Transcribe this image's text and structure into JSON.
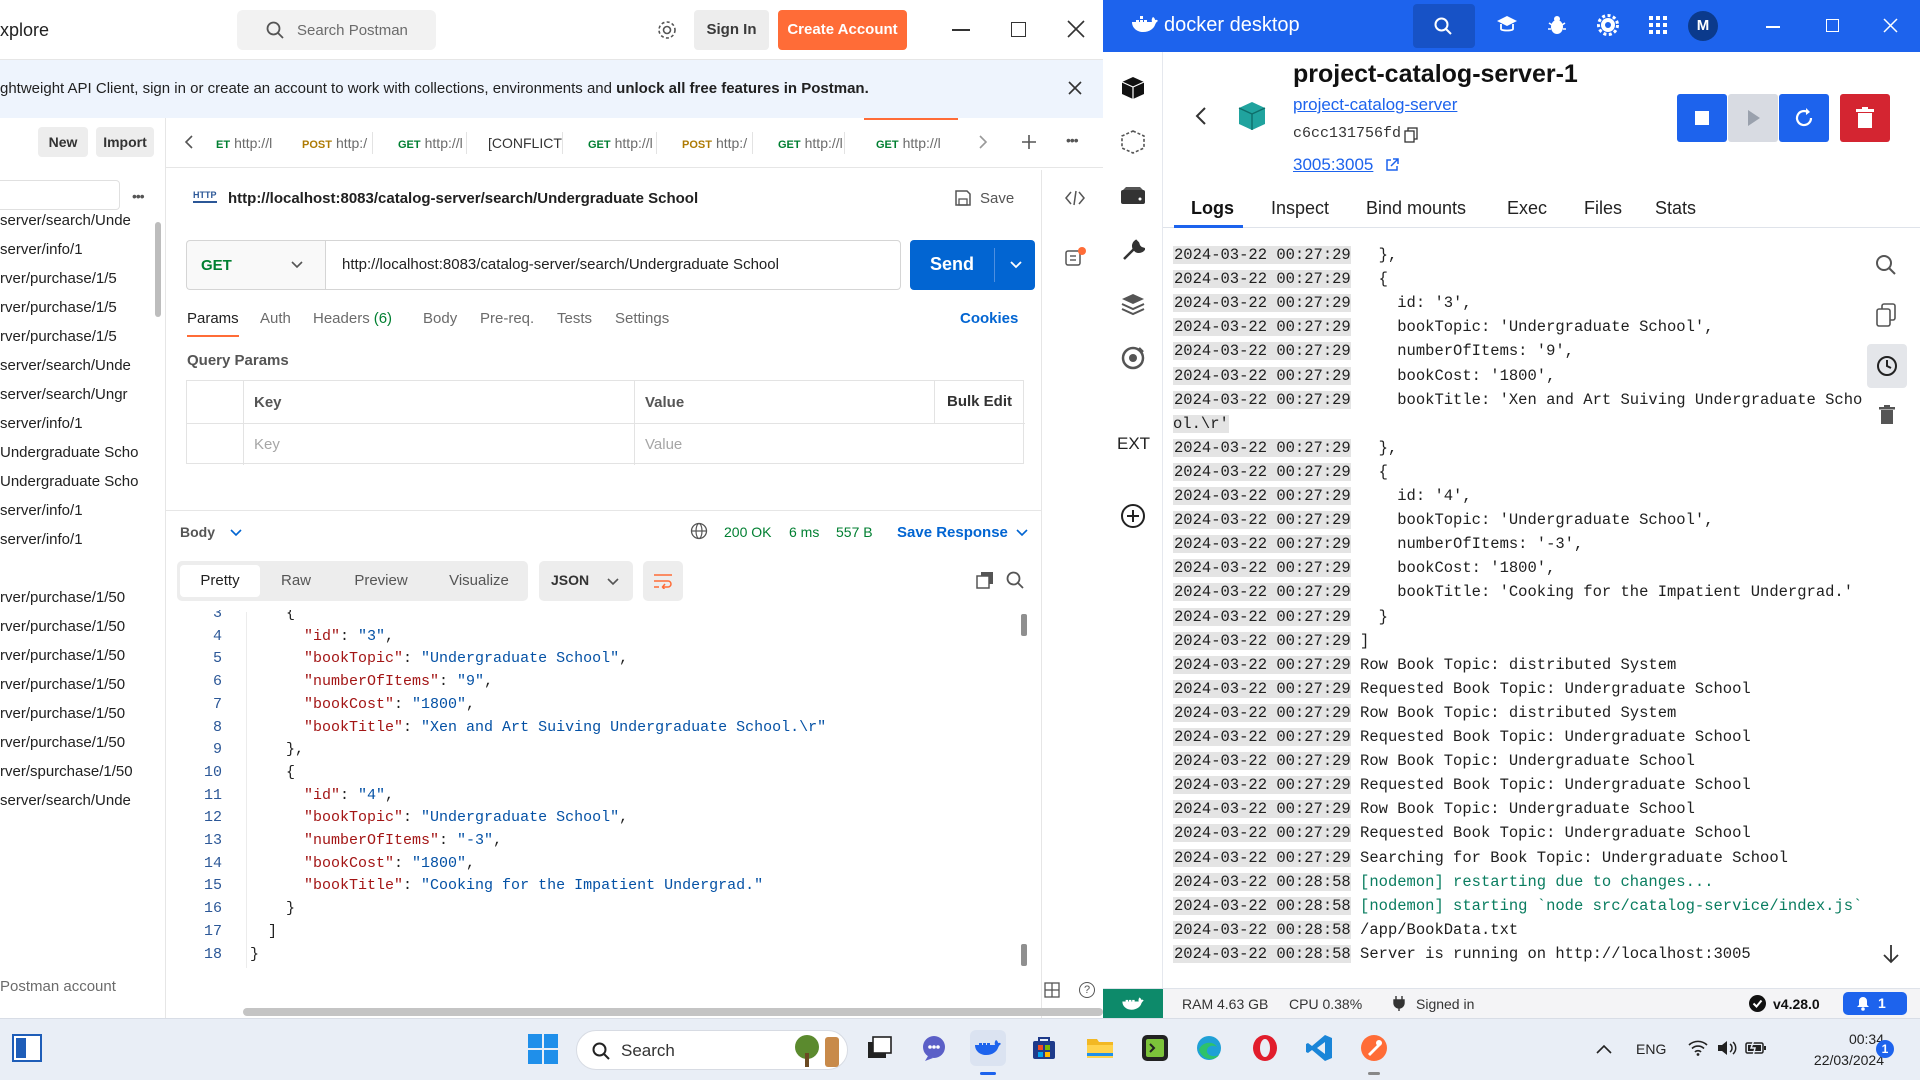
{
  "postman": {
    "title_fragment": "xplore",
    "search_placeholder": "Search Postman",
    "sign_in": "Sign In",
    "create_account": "Create Account",
    "banner": {
      "text": "ghtweight API Client, sign in or create an account to work with collections, environments and ",
      "bold": "unlock all free features in Postman."
    },
    "sidebar": {
      "new": "New",
      "import": "Import",
      "items": [
        "server/search/Unde",
        "server/info/1",
        "rver/purchase/1/5",
        "rver/purchase/1/5",
        "rver/purchase/1/5",
        "server/search/Unde",
        "server/search/Ungr",
        "server/info/1",
        "Undergraduate Scho",
        "Undergraduate Scho",
        "server/info/1",
        "server/info/1",
        "rver/purchase/1/50",
        "rver/purchase/1/50",
        "rver/purchase/1/50",
        "rver/purchase/1/50",
        "rver/purchase/1/50",
        "rver/purchase/1/50",
        "rver/spurchase/1/50",
        "server/search/Unde"
      ],
      "footer": "Postman account"
    },
    "tabs": [
      {
        "method": "ET",
        "url": "http://l",
        "mclass": "get"
      },
      {
        "method": "POST",
        "url": "http:/",
        "mclass": "post"
      },
      {
        "method": "GET",
        "url": "http://l",
        "mclass": "get"
      },
      {
        "method": "",
        "url": "[CONFLICT",
        "mclass": ""
      },
      {
        "method": "GET",
        "url": "http://l",
        "mclass": "get"
      },
      {
        "method": "POST",
        "url": "http:/",
        "mclass": "post"
      },
      {
        "method": "GET",
        "url": "http://l",
        "mclass": "get"
      },
      {
        "method": "GET",
        "url": "http://l",
        "mclass": "get"
      }
    ],
    "request": {
      "name": "http://localhost:8083/catalog-server/search/Undergraduate School",
      "save": "Save",
      "method": "GET",
      "url": "http://localhost:8083/catalog-server/search/Undergraduate School",
      "send": "Send",
      "subtabs": [
        "Params",
        "Auth",
        "Headers",
        "Body",
        "Pre-req.",
        "Tests",
        "Settings"
      ],
      "headers_count": "(6)",
      "cookies": "Cookies",
      "query_params": "Query Params",
      "col_key": "Key",
      "col_value": "Value",
      "bulk_edit": "Bulk Edit",
      "ph_key": "Key",
      "ph_value": "Value"
    },
    "response": {
      "body_label": "Body",
      "status": "200 OK",
      "time": "6 ms",
      "size": "557 B",
      "save_response": "Save Response",
      "views": [
        "Pretty",
        "Raw",
        "Preview",
        "Visualize"
      ],
      "format": "JSON",
      "lines": [
        {
          "n": "3",
          "indent": 4,
          "parts": [
            [
              "p",
              "{"
            ]
          ]
        },
        {
          "n": "4",
          "indent": 6,
          "parts": [
            [
              "k",
              "\"id\""
            ],
            [
              "p",
              ": "
            ],
            [
              "s",
              "\"3\""
            ],
            [
              "p",
              ","
            ]
          ]
        },
        {
          "n": "5",
          "indent": 6,
          "parts": [
            [
              "k",
              "\"bookTopic\""
            ],
            [
              "p",
              ": "
            ],
            [
              "s",
              "\"Undergraduate School\""
            ],
            [
              "p",
              ","
            ]
          ]
        },
        {
          "n": "6",
          "indent": 6,
          "parts": [
            [
              "k",
              "\"numberOfItems\""
            ],
            [
              "p",
              ": "
            ],
            [
              "s",
              "\"9\""
            ],
            [
              "p",
              ","
            ]
          ]
        },
        {
          "n": "7",
          "indent": 6,
          "parts": [
            [
              "k",
              "\"bookCost\""
            ],
            [
              "p",
              ": "
            ],
            [
              "s",
              "\"1800\""
            ],
            [
              "p",
              ","
            ]
          ]
        },
        {
          "n": "8",
          "indent": 6,
          "parts": [
            [
              "k",
              "\"bookTitle\""
            ],
            [
              "p",
              ": "
            ],
            [
              "s",
              "\"Xen and Art Suiving Undergraduate School.\\r\""
            ]
          ]
        },
        {
          "n": "9",
          "indent": 4,
          "parts": [
            [
              "p",
              "},"
            ]
          ]
        },
        {
          "n": "10",
          "indent": 4,
          "parts": [
            [
              "p",
              "{"
            ]
          ]
        },
        {
          "n": "11",
          "indent": 6,
          "parts": [
            [
              "k",
              "\"id\""
            ],
            [
              "p",
              ": "
            ],
            [
              "s",
              "\"4\""
            ],
            [
              "p",
              ","
            ]
          ]
        },
        {
          "n": "12",
          "indent": 6,
          "parts": [
            [
              "k",
              "\"bookTopic\""
            ],
            [
              "p",
              ": "
            ],
            [
              "s",
              "\"Undergraduate School\""
            ],
            [
              "p",
              ","
            ]
          ]
        },
        {
          "n": "13",
          "indent": 6,
          "parts": [
            [
              "k",
              "\"numberOfItems\""
            ],
            [
              "p",
              ": "
            ],
            [
              "s",
              "\"-3\""
            ],
            [
              "p",
              ","
            ]
          ]
        },
        {
          "n": "14",
          "indent": 6,
          "parts": [
            [
              "k",
              "\"bookCost\""
            ],
            [
              "p",
              ": "
            ],
            [
              "s",
              "\"1800\""
            ],
            [
              "p",
              ","
            ]
          ]
        },
        {
          "n": "15",
          "indent": 6,
          "parts": [
            [
              "k",
              "\"bookTitle\""
            ],
            [
              "p",
              ": "
            ],
            [
              "s",
              "\"Cooking for the Impatient Undergrad.\""
            ]
          ]
        },
        {
          "n": "16",
          "indent": 4,
          "parts": [
            [
              "p",
              "}"
            ]
          ]
        },
        {
          "n": "17",
          "indent": 2,
          "parts": [
            [
              "p",
              "]"
            ]
          ]
        },
        {
          "n": "18",
          "indent": 0,
          "parts": [
            [
              "p",
              "}"
            ]
          ]
        }
      ]
    }
  },
  "docker": {
    "app_name": "docker desktop",
    "avatar": "M",
    "container": {
      "name": "project-catalog-server-1",
      "project_link": "project-catalog-server",
      "id": "c6cc131756fd",
      "ports": "3005:3005"
    },
    "tabs": [
      "Logs",
      "Inspect",
      "Bind mounts",
      "Exec",
      "Files",
      "Stats"
    ],
    "active_tab": "Logs",
    "rail_ext": "EXT",
    "logs": [
      {
        "ts": "2024-03-22 00:27:29",
        "msg": "  },",
        "nodemon": false
      },
      {
        "ts": "2024-03-22 00:27:29",
        "msg": "  {",
        "nodemon": false
      },
      {
        "ts": "2024-03-22 00:27:29",
        "msg": "    id: '3',",
        "nodemon": false
      },
      {
        "ts": "2024-03-22 00:27:29",
        "msg": "    bookTopic: 'Undergraduate School',",
        "nodemon": false
      },
      {
        "ts": "2024-03-22 00:27:29",
        "msg": "    numberOfItems: '9',",
        "nodemon": false
      },
      {
        "ts": "2024-03-22 00:27:29",
        "msg": "    bookCost: '1800',",
        "nodemon": false
      },
      {
        "ts": "2024-03-22 00:27:29",
        "msg": "    bookTitle: 'Xen and Art Suiving Undergraduate Scho",
        "nodemon": false
      },
      {
        "ts": "",
        "msg": "ol.\\r'",
        "nodemon": false
      },
      {
        "ts": "2024-03-22 00:27:29",
        "msg": "  },",
        "nodemon": false
      },
      {
        "ts": "2024-03-22 00:27:29",
        "msg": "  {",
        "nodemon": false
      },
      {
        "ts": "2024-03-22 00:27:29",
        "msg": "    id: '4',",
        "nodemon": false
      },
      {
        "ts": "2024-03-22 00:27:29",
        "msg": "    bookTopic: 'Undergraduate School',",
        "nodemon": false
      },
      {
        "ts": "2024-03-22 00:27:29",
        "msg": "    numberOfItems: '-3',",
        "nodemon": false
      },
      {
        "ts": "2024-03-22 00:27:29",
        "msg": "    bookCost: '1800',",
        "nodemon": false
      },
      {
        "ts": "2024-03-22 00:27:29",
        "msg": "    bookTitle: 'Cooking for the Impatient Undergrad.'",
        "nodemon": false
      },
      {
        "ts": "2024-03-22 00:27:29",
        "msg": "  }",
        "nodemon": false
      },
      {
        "ts": "2024-03-22 00:27:29",
        "msg": "]",
        "nodemon": false
      },
      {
        "ts": "2024-03-22 00:27:29",
        "msg": "Row Book Topic: distributed System",
        "nodemon": false
      },
      {
        "ts": "2024-03-22 00:27:29",
        "msg": "Requested Book Topic: Undergraduate School",
        "nodemon": false
      },
      {
        "ts": "2024-03-22 00:27:29",
        "msg": "Row Book Topic: distributed System",
        "nodemon": false
      },
      {
        "ts": "2024-03-22 00:27:29",
        "msg": "Requested Book Topic: Undergraduate School",
        "nodemon": false
      },
      {
        "ts": "2024-03-22 00:27:29",
        "msg": "Row Book Topic: Undergraduate School",
        "nodemon": false
      },
      {
        "ts": "2024-03-22 00:27:29",
        "msg": "Requested Book Topic: Undergraduate School",
        "nodemon": false
      },
      {
        "ts": "2024-03-22 00:27:29",
        "msg": "Row Book Topic: Undergraduate School",
        "nodemon": false
      },
      {
        "ts": "2024-03-22 00:27:29",
        "msg": "Requested Book Topic: Undergraduate School",
        "nodemon": false
      },
      {
        "ts": "2024-03-22 00:27:29",
        "msg": "Searching for Book Topic: Undergraduate School",
        "nodemon": false
      },
      {
        "ts": "2024-03-22 00:28:58",
        "msg": "[nodemon] restarting due to changes...",
        "nodemon": true
      },
      {
        "ts": "2024-03-22 00:28:58",
        "msg": "[nodemon] starting `node src/catalog-service/index.js`",
        "nodemon": true
      },
      {
        "ts": "2024-03-22 00:28:58",
        "msg": "/app/BookData.txt",
        "nodemon": false
      },
      {
        "ts": "2024-03-22 00:28:58",
        "msg": "Server is running on http://localhost:3005",
        "nodemon": false
      }
    ],
    "status": {
      "ram": "RAM 4.63 GB",
      "cpu": "CPU 0.38%",
      "signed": "Signed in",
      "version": "v4.28.0",
      "notifications": "1"
    },
    "colors": {
      "brand": "#1d63ed",
      "stop": "#d42531"
    }
  },
  "taskbar": {
    "search": "Search",
    "lang": "ENG",
    "time": "00:34",
    "date": "22/03/2024",
    "notif": "1"
  }
}
